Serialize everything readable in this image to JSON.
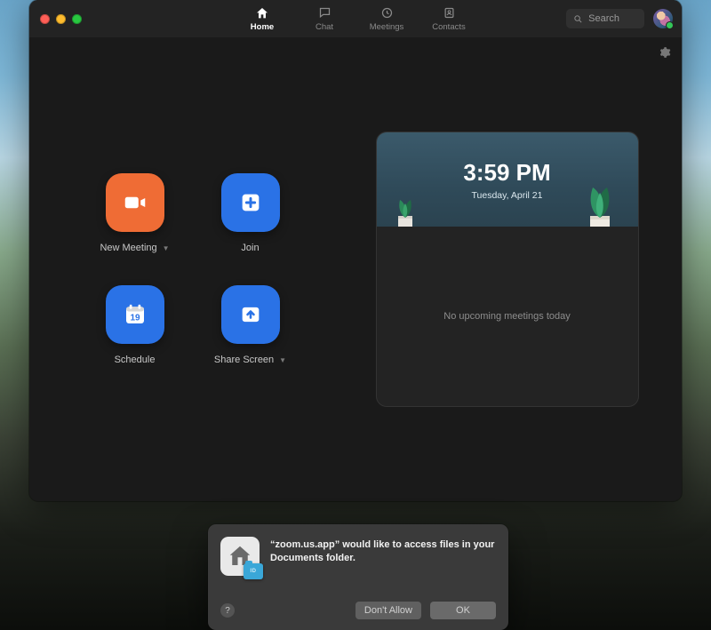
{
  "nav": {
    "home": "Home",
    "chat": "Chat",
    "meetings": "Meetings",
    "contacts": "Contacts"
  },
  "search": {
    "placeholder": "Search"
  },
  "tiles": {
    "new_meeting": "New Meeting",
    "join": "Join",
    "schedule": "Schedule",
    "schedule_day": "19",
    "share_screen": "Share Screen"
  },
  "clock": {
    "time": "3:59 PM",
    "date": "Tuesday, April 21"
  },
  "upcoming": {
    "empty": "No upcoming meetings today"
  },
  "dialog": {
    "message": "“zoom.us.app” would like to access files in your Documents folder.",
    "dont_allow": "Don't Allow",
    "ok": "OK",
    "badge": "ID"
  },
  "colors": {
    "orange": "#ef6c35",
    "blue": "#2a72e6",
    "card_head": "#3b5a6b"
  }
}
